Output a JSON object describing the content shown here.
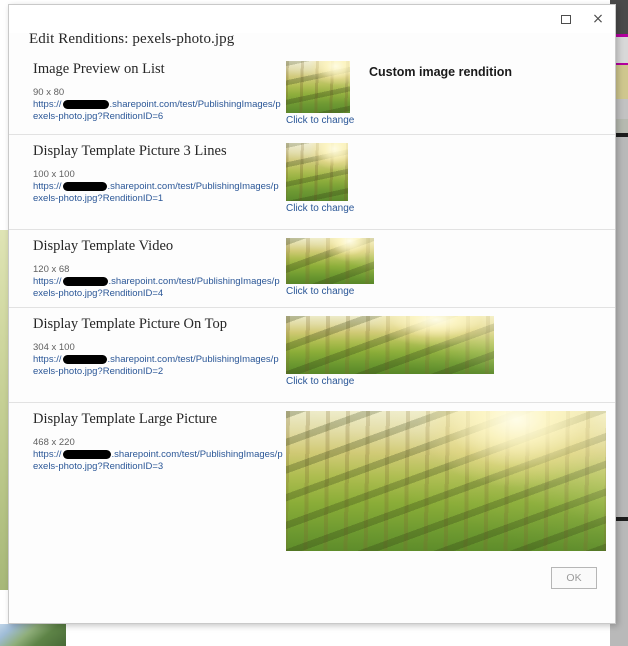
{
  "dialog": {
    "title": "Edit Renditions: pexels-photo.jpg",
    "window_controls": {
      "restore": "restore-icon",
      "close": "×"
    },
    "custom_rendition_label": "Custom image rendition",
    "click_to_change_label": "Click to change",
    "ok_label": "OK",
    "link_color": "#2b5797",
    "accent_text_color": "#262626"
  },
  "renditions": [
    {
      "name": "Image Preview on List",
      "dimensions": "90 x 80",
      "url_prefix": "https://",
      "url_suffix": ".sharepoint.com/test/PublishingImages/pexels-photo.jpg?RenditionID=6",
      "rendition_id": "6",
      "redacted": true,
      "thumb_w": 64,
      "thumb_h": 52,
      "is_custom": true,
      "click_to_change": "Click to change"
    },
    {
      "name": "Display Template Picture 3 Lines",
      "dimensions": "100 x 100",
      "url_prefix": "https://",
      "url_suffix": ".sharepoint.com/test/PublishingImages/pexels-photo.jpg?RenditionID=1",
      "rendition_id": "1",
      "redacted": true,
      "thumb_w": 62,
      "thumb_h": 58,
      "is_custom": false,
      "click_to_change": "Click to change"
    },
    {
      "name": "Display Template Video",
      "dimensions": "120 x 68",
      "url_prefix": "https://",
      "url_suffix": ".sharepoint.com/test/PublishingImages/pexels-photo.jpg?RenditionID=4",
      "rendition_id": "4",
      "redacted": true,
      "thumb_w": 88,
      "thumb_h": 46,
      "is_custom": false,
      "click_to_change": "Click to change"
    },
    {
      "name": "Display Template Picture On Top",
      "dimensions": "304 x 100",
      "url_prefix": "https://",
      "url_suffix": ".sharepoint.com/test/PublishingImages/pexels-photo.jpg?RenditionID=2",
      "rendition_id": "2",
      "redacted": true,
      "thumb_w": 208,
      "thumb_h": 58,
      "is_custom": false,
      "click_to_change": "Click to change"
    },
    {
      "name": "Display Template Large Picture",
      "dimensions": "468 x 220",
      "url_prefix": "https://",
      "url_suffix": ".sharepoint.com/test/PublishingImages/pexels-photo.jpg?RenditionID=3",
      "rendition_id": "3",
      "redacted": true,
      "thumb_w": 320,
      "thumb_h": 148,
      "is_custom": false,
      "click_to_change": "Click to change"
    }
  ]
}
